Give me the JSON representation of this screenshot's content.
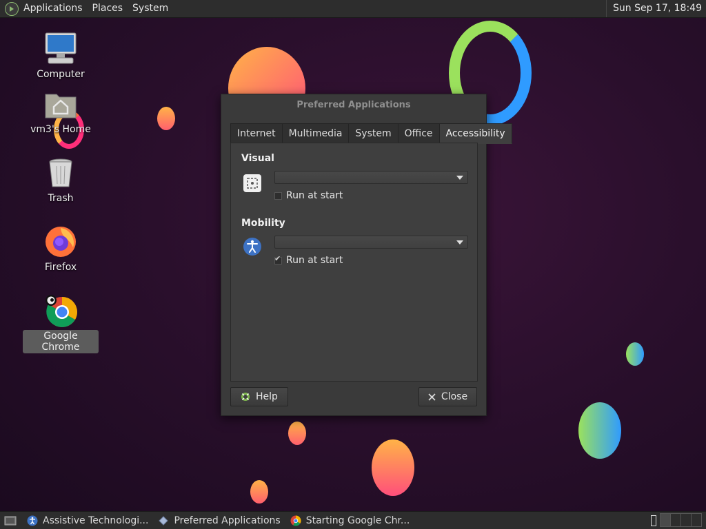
{
  "top_panel": {
    "menu": [
      "Applications",
      "Places",
      "System"
    ],
    "clock": "Sun Sep 17, 18:49"
  },
  "desktop_icons": [
    {
      "label": "Computer",
      "icon": "computer-icon"
    },
    {
      "label": "vm3's Home",
      "icon": "home-folder-icon"
    },
    {
      "label": "Trash",
      "icon": "trash-icon"
    },
    {
      "label": "Firefox",
      "icon": "firefox-icon"
    },
    {
      "label": "Google Chrome",
      "icon": "chrome-icon",
      "selected": true
    }
  ],
  "dialog": {
    "title": "Preferred Applications",
    "tabs": [
      "Internet",
      "Multimedia",
      "System",
      "Office",
      "Accessibility"
    ],
    "active_tab": "Accessibility",
    "visual": {
      "heading": "Visual",
      "selected_app": "",
      "run_at_start_label": "Run at start",
      "run_at_start_checked": false
    },
    "mobility": {
      "heading": "Mobility",
      "selected_app": "",
      "run_at_start_label": "Run at start",
      "run_at_start_checked": true
    },
    "help_label": "Help",
    "close_label": "Close"
  },
  "taskbar": {
    "tasks": [
      {
        "label": "Assistive Technologi...",
        "icon": "accessibility-icon"
      },
      {
        "label": "Preferred Applications",
        "icon": "diamond-icon"
      },
      {
        "label": "Starting Google Chr...",
        "icon": "chrome-icon"
      }
    ]
  },
  "colors": {
    "panel": "#2d2d2d",
    "dialog": "#3a3a3a",
    "desktop": "#2a0f2c"
  }
}
